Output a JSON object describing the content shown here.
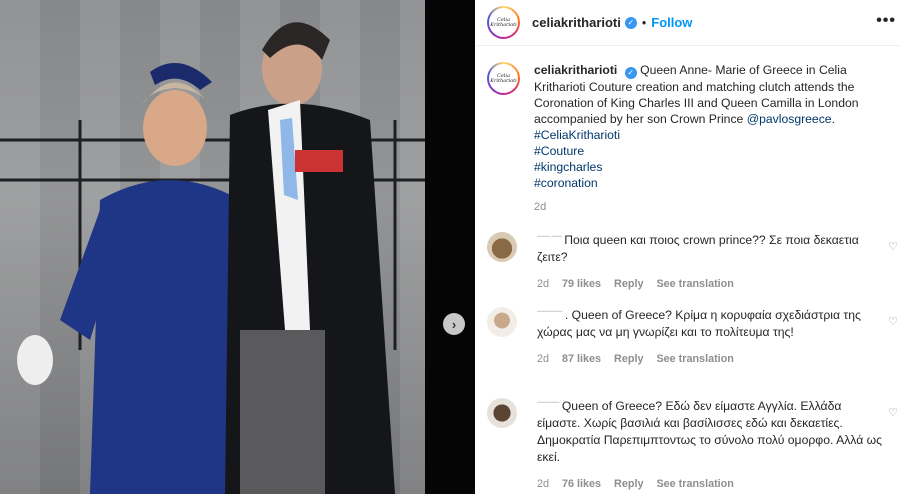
{
  "photo": {
    "next_button": "›"
  },
  "header": {
    "username": "celiakritharioti",
    "verified": "✓",
    "separator": "•",
    "follow_label": "Follow",
    "more_label": "•••",
    "avatar_text": "Celia Kritharioti"
  },
  "caption": {
    "username": "celiakritharioti",
    "text_1": "Queen Anne- Marie of Greece in Celia Kritharioti Couture creation and matching clutch attends the Coronation of King Charles III and Queen Camilla in London accompanied by her son Crown Prince ",
    "mention": "@pavlosgreece",
    "text_2": ".",
    "hashtags": [
      "#CeliaKritharioti",
      "#Couture",
      "#kingcharles",
      "#coronation"
    ],
    "time": "2d"
  },
  "comments": [
    {
      "username_blur": "˜˜˜˜ ˜˜˜",
      "text": "Ποια queen και ποιος crown prince?? Σε ποια δεκαετια ζειτε?",
      "time": "2d",
      "likes": "79 likes",
      "reply": "Reply",
      "translate": "See translation"
    },
    {
      "username_blur": "˜˜˜˜˜˜˜˜",
      "text": ". Queen of Greece? Κρίμα η κορυφαία σχεδιάστρια της χώρας μας να μη γνωρίζει και το πολίτευμα της!",
      "time": "2d",
      "likes": "87 likes",
      "reply": "Reply",
      "translate": "See translation"
    },
    {
      "username_blur": "˜˜˜˜˜˜˜",
      "text": "Queen of Greece? Εδώ δεν είμαστε Αγγλία. Ελλάδα είμαστε. Χωρίς βασιλιά και βασίλισσες εδώ και δεκαετίες. Δημοκρατία Παρεπιμπτοντως το σύνολο πολύ ομορφο. Αλλά ως εκεί.",
      "time": "2d",
      "likes": "76 likes",
      "reply": "Reply",
      "translate": "See translation"
    }
  ],
  "colors": {
    "accent": "#0095f6",
    "link": "#00376b",
    "muted": "#8e8e8e",
    "verified": "#3897f0"
  }
}
